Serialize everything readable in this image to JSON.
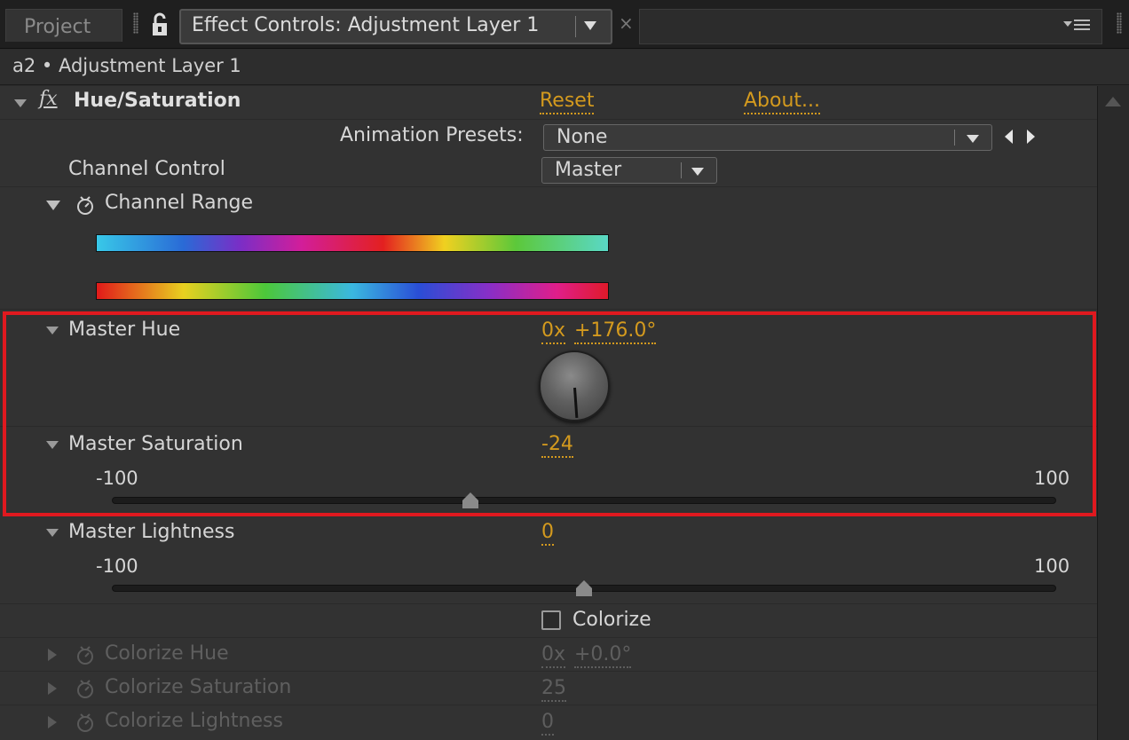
{
  "tabs": {
    "project": "Project",
    "active": "Effect Controls: Adjustment Layer 1",
    "close": "×"
  },
  "layer_path": "a2 • Adjustment Layer 1",
  "effect": {
    "fx_symbol": "fx",
    "name": "Hue/Saturation",
    "reset": "Reset",
    "about": "About...",
    "animation_presets_label": "Animation Presets:",
    "animation_presets_value": "None",
    "channel_control_label": "Channel Control",
    "channel_control_value": "Master",
    "channel_range_label": "Channel Range"
  },
  "master_hue": {
    "label": "Master Hue",
    "revolutions": "0x",
    "degrees": "+176.0°"
  },
  "master_saturation": {
    "label": "Master Saturation",
    "value": "-24",
    "min": "-100",
    "max": "100",
    "fraction": 0.38
  },
  "master_lightness": {
    "label": "Master Lightness",
    "value": "0",
    "min": "-100",
    "max": "100",
    "fraction": 0.5
  },
  "colorize": {
    "label": "Colorize",
    "hue_label": "Colorize Hue",
    "hue_rev": "0x",
    "hue_deg": "+0.0°",
    "sat_label": "Colorize Saturation",
    "sat_value": "25",
    "light_label": "Colorize Lightness",
    "light_value": "0"
  },
  "colors": {
    "accent_value": "#d49a1e",
    "highlight_box": "#e0191f",
    "panel_bg": "#323232"
  },
  "icons": [
    "lock-icon",
    "panel-menu-icon",
    "twirl-down-icon",
    "stopwatch-icon",
    "dropdown-arrow-icon",
    "prev-keyframe-icon",
    "next-keyframe-icon",
    "scroll-up-icon"
  ]
}
